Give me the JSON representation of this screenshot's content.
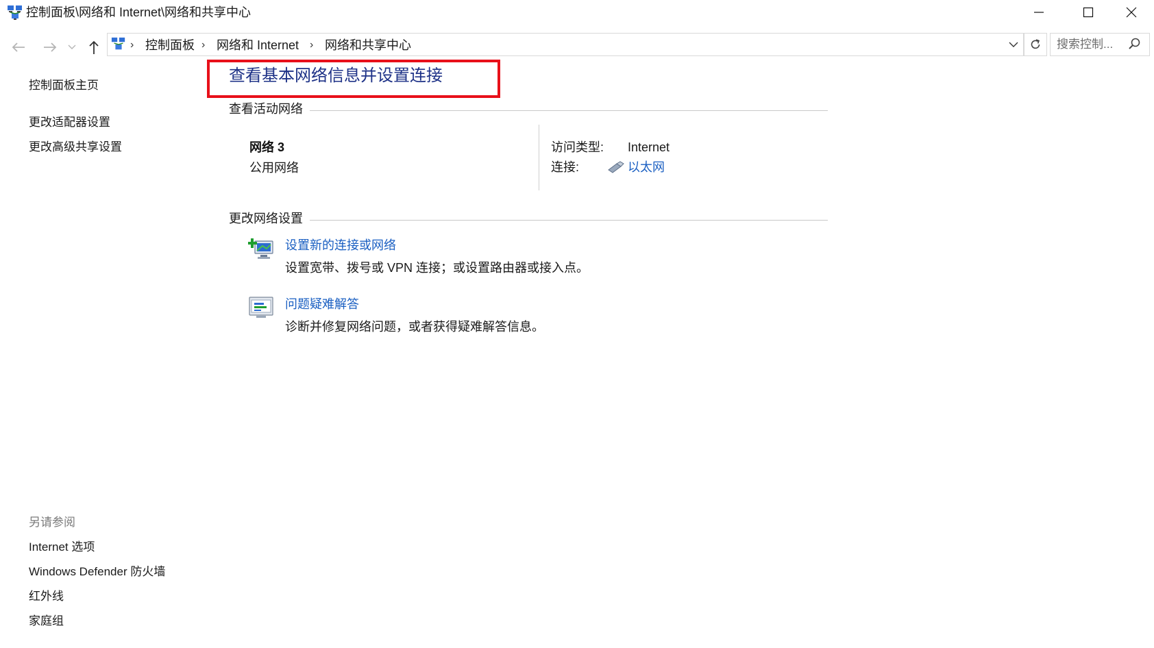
{
  "window": {
    "title": "控制面板\\网络和 Internet\\网络和共享中心",
    "app_icon": "network-sharing-icon",
    "controls": [
      "minimize-icon",
      "maximize-icon",
      "close-icon"
    ]
  },
  "addressbar": {
    "crumbs": [
      "控制面板",
      "网络和 Internet",
      "网络和共享中心"
    ],
    "search_placeholder": "搜索控制..."
  },
  "sidebar": {
    "links": [
      "控制面板主页",
      "更改适配器设置",
      "更改高级共享设置"
    ],
    "see_also_title": "另请参阅",
    "see_also": [
      "Internet 选项",
      "Windows Defender 防火墙",
      "红外线",
      "家庭组"
    ]
  },
  "main": {
    "title": "查看基本网络信息并设置连接",
    "active_section": "查看活动网络",
    "network": {
      "name": "网络  3",
      "type": "公用网络",
      "access_label": "访问类型:",
      "access_value": "Internet",
      "connection_label": "连接:",
      "connection_value": "以太网"
    },
    "settings_section": "更改网络设置",
    "tasks": [
      {
        "link": "设置新的连接或网络",
        "desc": "设置宽带、拨号或 VPN 连接；或设置路由器或接入点。",
        "icon": "new-connection-icon"
      },
      {
        "link": "问题疑难解答",
        "desc": "诊断并修复网络问题，或者获得疑难解答信息。",
        "icon": "troubleshoot-icon"
      }
    ]
  },
  "colors": {
    "highlight_border": "#e8101a",
    "title_blue": "#1e3287",
    "link_blue": "#1a5fc2"
  }
}
